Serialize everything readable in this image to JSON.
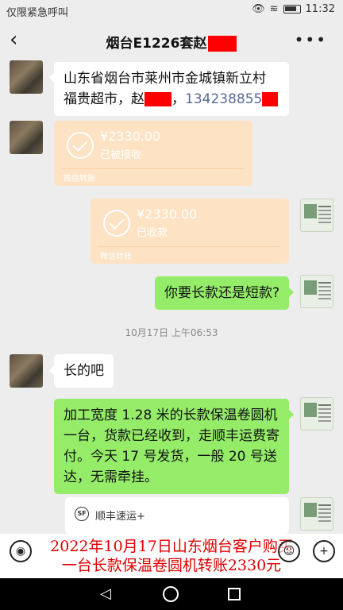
{
  "status_bar": {
    "carrier": "仅限紧急呼叫",
    "time": "11:32"
  },
  "header": {
    "title": "烟台E1226套赵",
    "back_icon": "chevron-left-icon",
    "more_icon": "more-dots-icon"
  },
  "messages": {
    "address_line1": "山东省烟台市莱州市金城镇新立村",
    "address_line2_prefix": "福贵超市，赵",
    "address_phone": "134238855",
    "transfer1": {
      "amount": "¥2330.00",
      "status": "已被接收",
      "source": "微信转账"
    },
    "transfer2": {
      "amount": "¥2330.00",
      "status": "已收款",
      "source": "微信转账"
    },
    "question": "你要长款还是短款?",
    "timestamp": "10月17日 上午06:53",
    "reply": "长的吧",
    "detail": "加工宽度 1.28 米的长款保温卷圆机一台，货款已经收到，走顺丰运费寄付。今天 17 号发货，一般 20 号送达，无需牵挂。",
    "card": {
      "logo": "SF",
      "name": "顺丰速运+"
    }
  },
  "caption": {
    "line1": "2022年10月17日山东烟台客户购买",
    "line2": "一台长款保温卷圆机转账2330元"
  },
  "nav": {
    "back": "◁",
    "home": "",
    "recent": ""
  },
  "colors": {
    "accent_green": "#95ec69",
    "transfer_orange": "#fde2c4",
    "redaction": "#ff0000",
    "caption_red": "#e00000"
  }
}
